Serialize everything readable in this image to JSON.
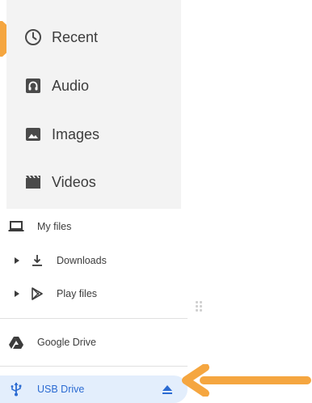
{
  "quick_access": {
    "items": [
      {
        "label": "Recent",
        "icon": "clock-icon"
      },
      {
        "label": "Audio",
        "icon": "audio-icon"
      },
      {
        "label": "Images",
        "icon": "image-icon"
      },
      {
        "label": "Videos",
        "icon": "video-icon"
      }
    ]
  },
  "navigation": {
    "my_files": {
      "label": "My files",
      "icon": "laptop-icon"
    },
    "downloads": {
      "label": "Downloads",
      "icon": "download-icon"
    },
    "play_files": {
      "label": "Play files",
      "icon": "play-store-icon"
    },
    "google_drive": {
      "label": "Google Drive",
      "icon": "google-drive-icon"
    },
    "usb_drive": {
      "label": "USB Drive",
      "icon": "usb-icon",
      "selected": true
    }
  },
  "colors": {
    "annotation_arrow": "#f5a640",
    "selected_bg": "#e3eefc",
    "selected_text": "#2b6bd2",
    "panel_bg": "#f3f3f3"
  }
}
